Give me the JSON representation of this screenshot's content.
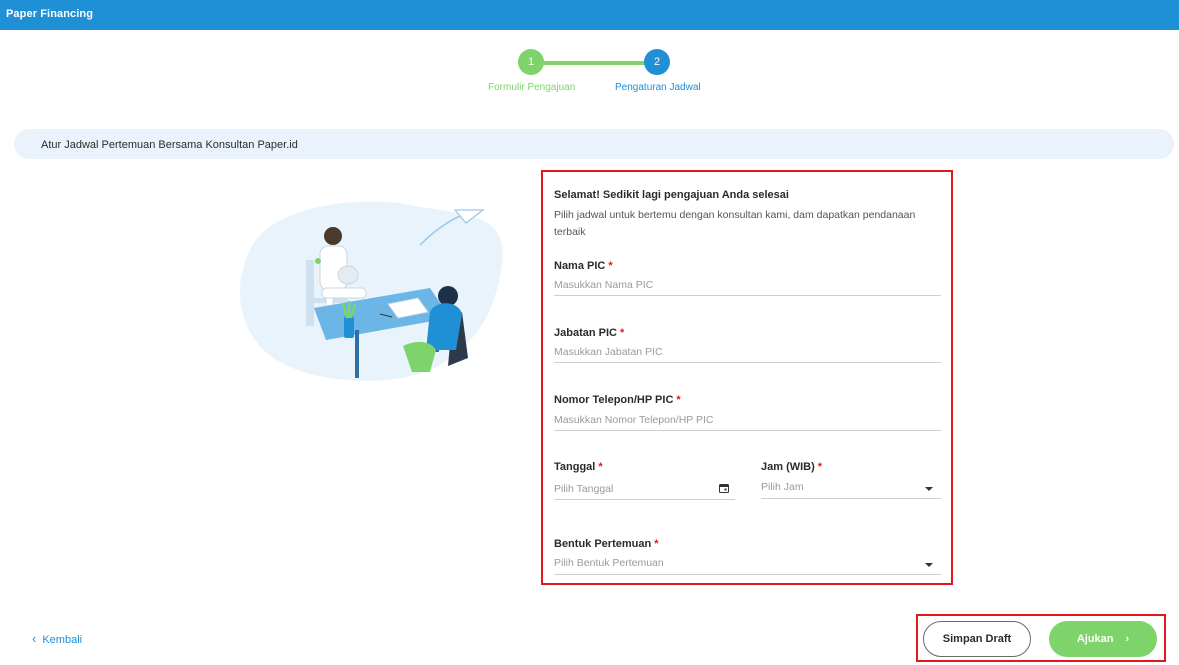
{
  "app": {
    "title": "Paper Financing"
  },
  "stepper": {
    "steps": [
      {
        "number": "1",
        "label": "Formulir Pengajuan"
      },
      {
        "number": "2",
        "label": "Pengaturan Jadwal"
      }
    ]
  },
  "banner": {
    "text": "Atur Jadwal Pertemuan Bersama Konsultan Paper.id"
  },
  "form": {
    "intro_title": "Selamat! Sedikit lagi pengajuan Anda selesai",
    "intro_desc": "Pilih jadwal untuk bertemu dengan konsultan kami, dam dapatkan pendanaan terbaik",
    "required_mark": "*",
    "nama_pic": {
      "label": "Nama PIC",
      "placeholder": "Masukkan Nama PIC"
    },
    "jabatan_pic": {
      "label": "Jabatan PIC",
      "placeholder": "Masukkan Jabatan PIC"
    },
    "telepon_pic": {
      "label": "Nomor Telepon/HP PIC",
      "placeholder": "Masukkan Nomor Telepon/HP PIC"
    },
    "tanggal": {
      "label": "Tanggal",
      "placeholder": "Pilih Tanggal"
    },
    "jam": {
      "label": "Jam (WIB)",
      "placeholder": "Pilih Jam"
    },
    "bentuk": {
      "label": "Bentuk Pertemuan",
      "placeholder": "Pilih Bentuk Pertemuan"
    }
  },
  "footer": {
    "back_label": "Kembali",
    "draft_label": "Simpan Draft",
    "submit_label": "Ajukan"
  },
  "colors": {
    "primary": "#1f8fd6",
    "success": "#7ed36b",
    "highlight": "#e3171e"
  }
}
